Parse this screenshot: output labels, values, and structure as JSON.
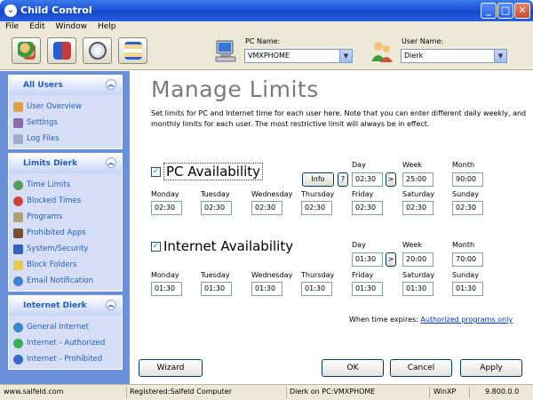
{
  "window": {
    "title": "Child Control"
  },
  "menu": [
    "File",
    "Edit",
    "Window",
    "Help"
  ],
  "toolbar": {
    "pc_label": "PC Name:",
    "pc_value": "VMXPHOME",
    "user_label": "User Name:",
    "user_value": "Dierk"
  },
  "sidebar": {
    "all_users": {
      "title": "All Users",
      "items": [
        "User Overview",
        "Settings",
        "Log Files"
      ]
    },
    "limits": {
      "title": "Limits Dierk",
      "items": [
        "Time Limits",
        "Blocked Times",
        "Programs",
        "Prohibited Apps",
        "System/Security",
        "Block Folders",
        "Email Notification"
      ]
    },
    "internet": {
      "title": "Internet Dierk",
      "items": [
        "General Internet",
        "Internet - Authorized",
        "Internet - Prohibited"
      ]
    }
  },
  "main": {
    "heading": "Manage Limits",
    "intro": "Set limits for PC and Internet time for each user here. Note that you can enter different daily weekly, and monthly limits for each user. The most restrictive limit will always be in effect.",
    "pc": {
      "title": "PC Availability",
      "checked": true,
      "info": "Info",
      "help": "?",
      "arrow": ">",
      "period_labels": [
        "Day",
        "Week",
        "Month"
      ],
      "period_values": [
        "02:30",
        "25:00",
        "90:00"
      ],
      "days": [
        "Monday",
        "Tuesday",
        "Wednesday",
        "Thursday",
        "Friday",
        "Saturday",
        "Sunday"
      ],
      "day_values": [
        "02:30",
        "02:30",
        "02:30",
        "02:30",
        "02:30",
        "02:30",
        "02:30"
      ]
    },
    "internet": {
      "title": "Internet Availability",
      "checked": true,
      "arrow": ">",
      "period_labels": [
        "Day",
        "Week",
        "Month"
      ],
      "period_values": [
        "01:30",
        "20:00",
        "70:00"
      ],
      "days": [
        "Monday",
        "Tuesday",
        "Wednesday",
        "Thursday",
        "Friday",
        "Saturday",
        "Sunday"
      ],
      "day_values": [
        "01:30",
        "01:30",
        "01:30",
        "01:30",
        "01:30",
        "01:30",
        "01:30"
      ]
    },
    "expire_label": "When time expires:",
    "expire_link": "Authorized programs only",
    "buttons": {
      "wizard": "Wizard",
      "ok": "OK",
      "cancel": "Cancel",
      "apply": "Apply"
    }
  },
  "status": {
    "site": "www.salfeld.com",
    "registered": "Registered:Salfeld Computer",
    "session": "Dierk on PC:VMXPHOME",
    "os": "WinXP",
    "version": "9.800.0.0"
  }
}
